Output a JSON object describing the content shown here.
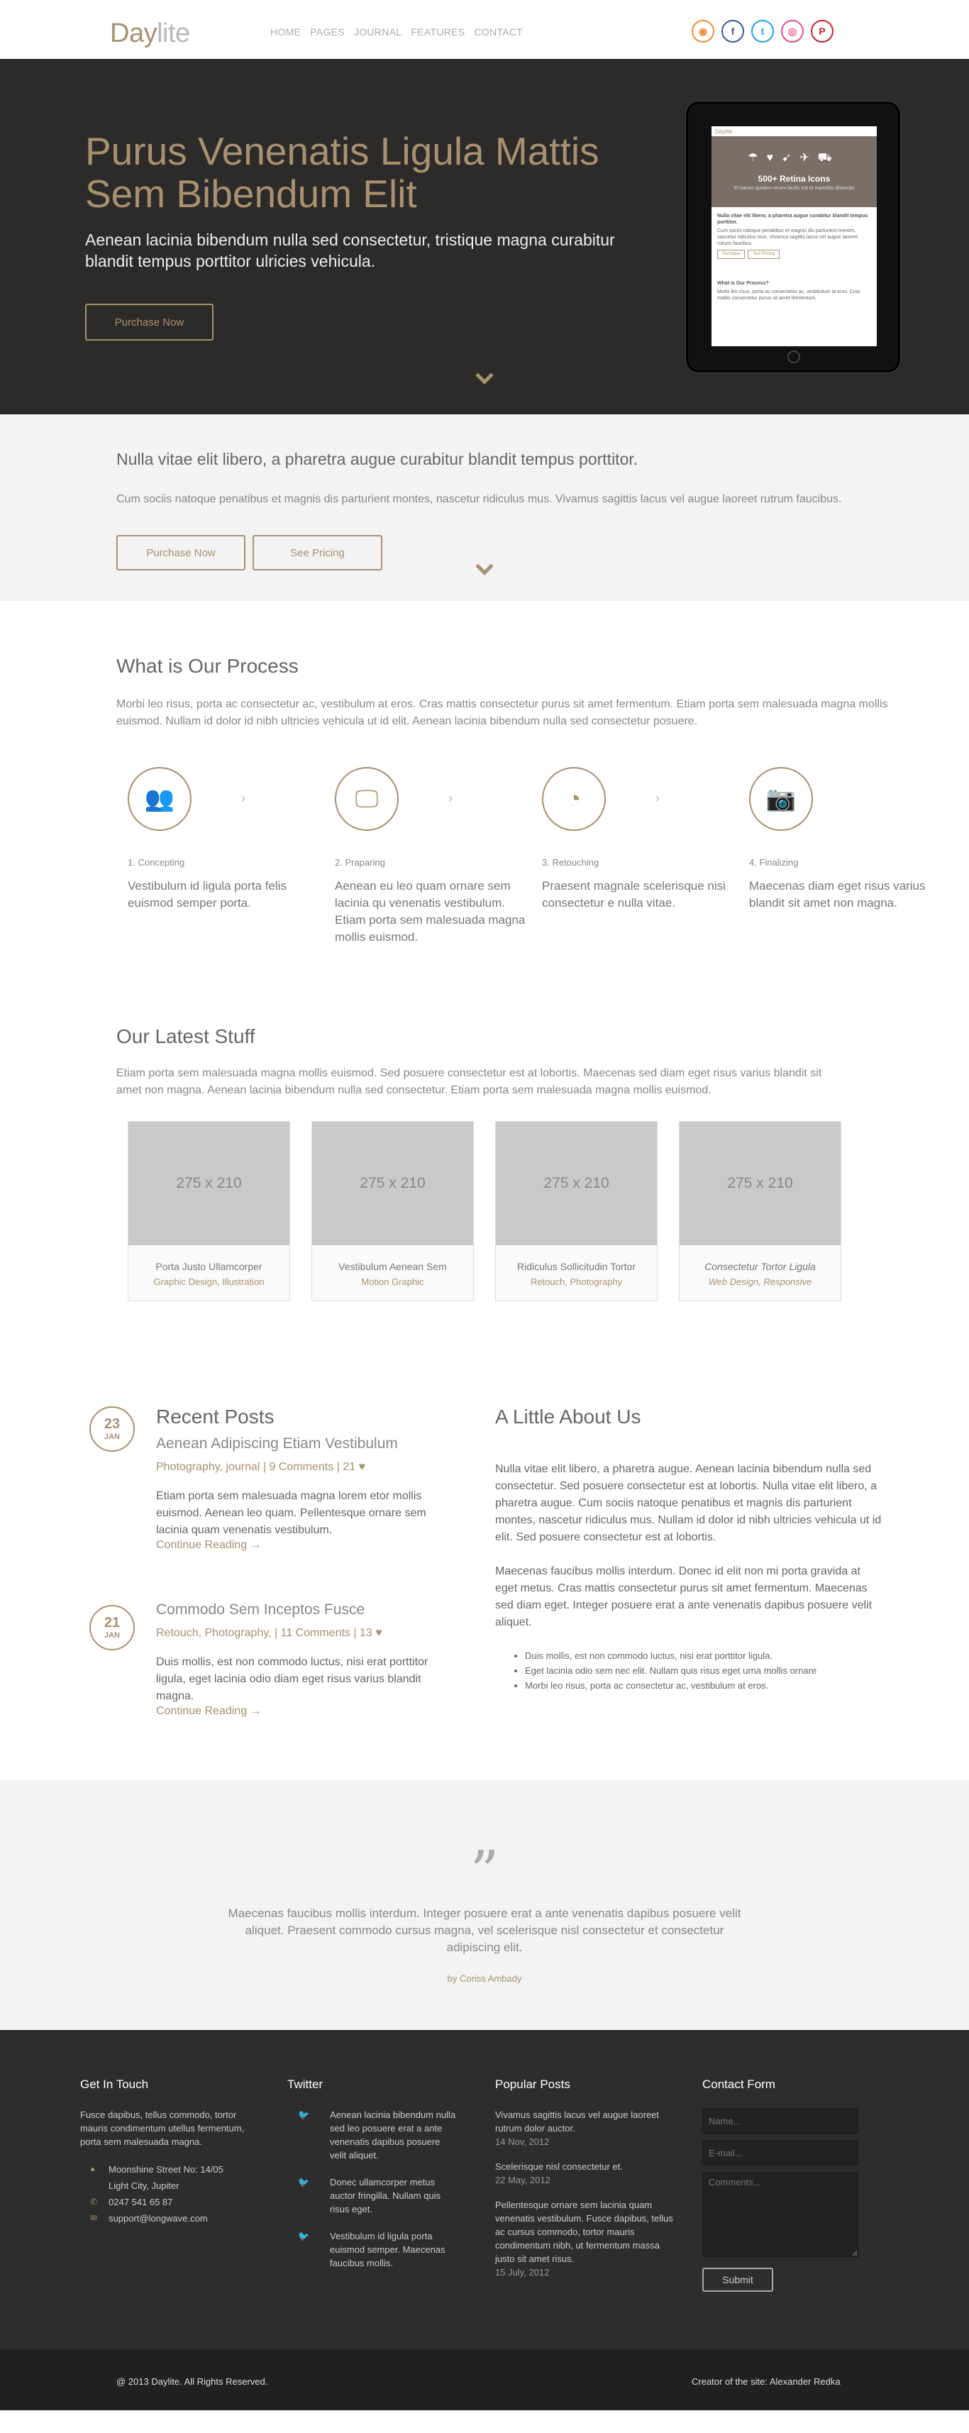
{
  "header": {
    "logo": {
      "part1": "Day",
      "part2": "lite"
    },
    "nav": [
      "HOME",
      "PAGES",
      "JOURNAL",
      "FEATURES",
      "CONTACT"
    ],
    "social": [
      {
        "name": "rss-icon",
        "glyph": "◉",
        "color": "#f08c3a"
      },
      {
        "name": "facebook-icon",
        "glyph": "f",
        "color": "#3b5998"
      },
      {
        "name": "twitter-icon",
        "glyph": "t",
        "color": "#1da1f2"
      },
      {
        "name": "dribbble-icon",
        "glyph": "◎",
        "color": "#ea4c89"
      },
      {
        "name": "pinterest-icon",
        "glyph": "P",
        "color": "#c8232c"
      }
    ]
  },
  "hero": {
    "title": "Purus Venenatis Ligula Mattis Sem Bibendum Elit",
    "subtitle": "Aenean lacinia bibendum nulla sed consectetur, tristique magna curabitur blandit tempus porttitor ulricies vehicula.",
    "button": "Purchase Now",
    "tablet": {
      "logo": "Daylite",
      "banner_title": "500+ Retina Icons",
      "banner_sub": "Et harum quidem rerum facilis est et expedita distinctio",
      "heading": "Nulla vitae elit libero, a pharetra augue curabitur blandit tempus porttitor.",
      "text": "Cum sociis natoque penatibus et magnis dis parturient montes, nascetur ridiculus mus. Vivamus sagittis lacus vel augue laoreet rutrum faucibus.",
      "btn1": "Purchase",
      "btn2": "See Pricing",
      "heading2": "What is Our Process?",
      "text2": "Morbi leo risus, porta ac consectetur ac, vestibulum at eros. Cras mattis consectetur purus sit amet fermentum."
    }
  },
  "band": {
    "title": "Nulla vitae elit libero, a pharetra augue curabitur blandit tempus porttitor.",
    "text": "Cum sociis natoque penatibus et magnis dis parturient montes, nascetur ridiculus mus. Vivamus sagittis lacus vel augue laoreet rutrum faucibus.",
    "button1": "Purchase Now",
    "button2": "See Pricing"
  },
  "process": {
    "title": "What is Our Process",
    "intro": "Morbi leo risus, porta ac consectetur ac, vestibulum at eros. Cras mattis consectetur purus sit amet fermentum. Etiam porta sem malesuada magna mollis euismod. Nullam id dolor id nibh ultricies vehicula ut id elit. Aenean lacinia bibendum nulla sed consectetur posuere.",
    "steps": [
      {
        "num": "1. Concepting",
        "text": "Vestibulum id ligula porta felis euismod semper porta.",
        "icon": "team-icon",
        "glyph": "👥"
      },
      {
        "num": "2. Praparing",
        "text": "Aenean eu leo quam ornare sem lacinia qu venenatis vestibulum. Etiam porta sem malesuada magna mollis euismod.",
        "icon": "monitor-icon",
        "glyph": "🖵"
      },
      {
        "num": "3. Retouching",
        "text": "Praesent magnale scelerisque nisi consectetur e nulla vitae.",
        "icon": "palette-icon",
        "glyph": "◔"
      },
      {
        "num": "4. Finalizing",
        "text": "Maecenas diam eget risus varius blandit sit amet non magna.",
        "icon": "camera-icon",
        "glyph": "📷"
      }
    ]
  },
  "latest": {
    "title": "Our Latest Stuff",
    "intro": "Etiam porta sem malesuada magna mollis euismod. Sed posuere consectetur est at lobortis. Maecenas sed diam eget risus varius blandit sit amet non magna. Aenean lacinia bibendum nulla sed consectetur. Etiam porta sem malesuada magna mollis euismod.",
    "items": [
      {
        "ph": "275 x 210",
        "title": "Porta Justo Ullamcorper",
        "sub": "Graphic Design, Illustration"
      },
      {
        "ph": "275 x 210",
        "title": "Vestibulum Aenean Sem",
        "sub": "Motion Graphic"
      },
      {
        "ph": "275 x 210",
        "title": "Ridiculus Sollicitudin Tortor",
        "sub": "Retouch, Photography"
      },
      {
        "ph": "275 x 210",
        "title": "Consectetur Tortor Ligula",
        "sub": "Web Design, Responsive"
      }
    ]
  },
  "posts": {
    "title": "Recent Posts",
    "items": [
      {
        "day": "23",
        "month": "JAN",
        "title": "Aenean Adipiscing Etiam Vestibulum",
        "meta": "Photography, journal | 9 Comments | 21 ♥",
        "body": "Etiam porta sem malesuada magna lorem etor mollis euismod. Aenean leo quam. Pellentesque ornare sem lacinia quam venenatis vestibulum.",
        "more": "Continue Reading →"
      },
      {
        "day": "21",
        "month": "JAN",
        "title": "Commodo Sem Inceptos Fusce",
        "meta": "Retouch, Photography, | 11 Comments | 13 ♥",
        "body": "Duis mollis, est non commodo luctus, nisi erat porttitor ligula, eget lacinia odio diam eget risus varius blandit magna.",
        "more": "Continue Reading →"
      }
    ]
  },
  "about": {
    "title": "A Little About Us",
    "p1": "Nulla vitae elit libero, a pharetra augue. Aenean lacinia bibendum nulla sed consectetur. Sed posuere consectetur est at lobortis. Nulla vitae elit libero, a pharetra augue. Cum sociis natoque penatibus et magnis dis parturient montes, nascetur ridiculus mus. Nullam id dolor id nibh ultricies vehicula ut id elit. Sed posuere consectetur est at lobortis.",
    "p2": "Maecenas faucibus mollis interdum. Donec id elit non mi porta gravida at eget metus. Cras mattis consectetur purus sit amet fermentum. Maecenas sed diam eget. Integer posuere erat a ante venenatis dapibus posuere velit aliquet.",
    "list": [
      "Duis mollis, est non commodo luctus, nisi erat porttitor ligula.",
      "Eget lacinia odio sem nec elit. Nullam quis risus eget urna mollis ornare",
      "Morbi leo risus, porta ac consectetur ac, vestibulum at eros."
    ]
  },
  "quote": {
    "mark": "”",
    "text": "Maecenas faucibus mollis interdum. Integer posuere erat a ante venenatis dapibus posuere velit aliquet. Praesent commodo cursus magna, vel scelerisque nisl consectetur et consectetur adipiscing elit.",
    "by": "by Coriss Ambady"
  },
  "footer": {
    "touch": {
      "title": "Get In Touch",
      "text": "Fusce dapibus, tellus commodo, tortor mauris condimentum utellus fermentum, porta sem malesuada magna.",
      "address": "Moonshine Street No: 14/05",
      "city": "Light City, Jupiter",
      "phone": "0247 541 65 87",
      "email": "support@longwave.com"
    },
    "twitter": {
      "title": "Twitter",
      "items": [
        "Aenean lacinia bibendum nulla sed leo posuere erat a ante venenatis dapibus posuere velit aliquet.",
        "Donec ullamcorper metus auctor fringilla. Nullam quis risus eget.",
        "Vestibulum id ligula porta euismod semper. Maecenas faucibus mollis."
      ]
    },
    "popular": {
      "title": "Popular Posts",
      "items": [
        {
          "text": "Vivamus sagittis lacus vel augue laoreet rutrum dolor auctor.",
          "date": "14 Nov, 2012"
        },
        {
          "text": "Scelerisque nisl consectetur et.",
          "date": "22 May, 2012"
        },
        {
          "text": "Pellentesque ornare sem lacinia quam venenatis vestibulum. Fusce dapibus, tellus ac cursus commodo, tortor mauris condimentum nibh, ut fermentum massa justo sit amet risus.",
          "date": "15 July, 2012"
        }
      ]
    },
    "contact": {
      "title": "Contact Form",
      "name_ph": "Name...",
      "email_ph": "E-mail...",
      "comments_ph": "Comments...",
      "submit": "Submit"
    }
  },
  "bottom": {
    "copyright": "@ 2013 Daylite. All Rights Reserved.",
    "credit": "Creator of the site: Alexander Redka"
  }
}
